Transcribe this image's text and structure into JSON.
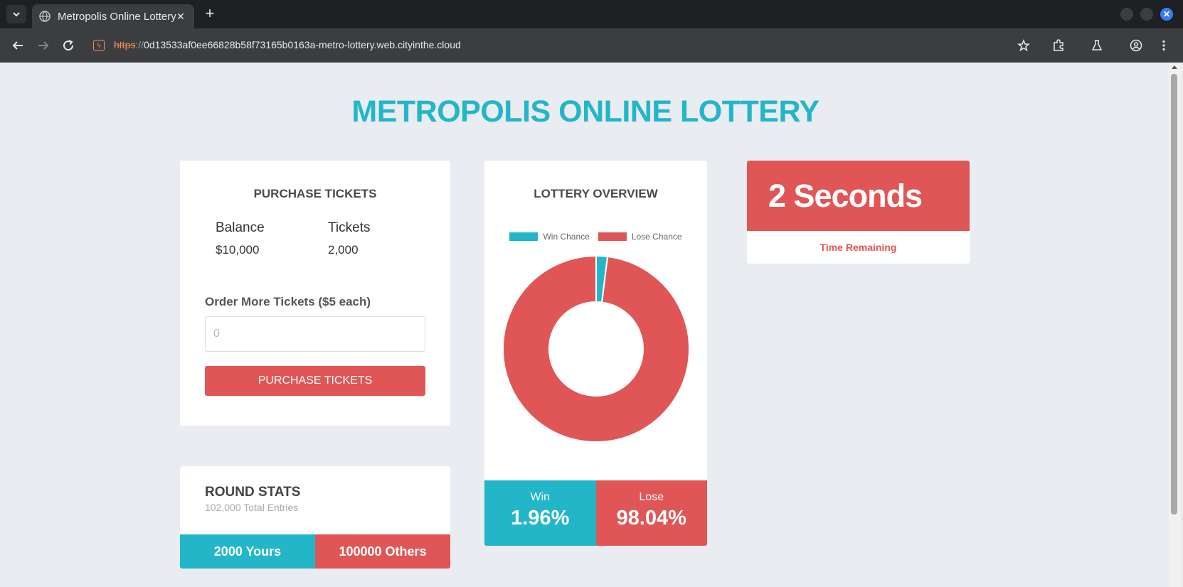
{
  "browser": {
    "tab_title": "Metropolis Online Lottery",
    "url_scheme": "https",
    "url_sep": "://",
    "url_host": "0d13533af0ee66828b58f73165b0163a-metro-lottery.web.cityinthe.cloud"
  },
  "page": {
    "title": "METROPOLIS ONLINE LOTTERY"
  },
  "purchase": {
    "heading": "PURCHASE TICKETS",
    "balance_label": "Balance",
    "balance_value": "$10,000",
    "tickets_label": "Tickets",
    "tickets_value": "2,000",
    "order_label": "Order More Tickets ($5 each)",
    "input_placeholder": "0",
    "button_label": "PURCHASE TICKETS"
  },
  "overview": {
    "heading": "LOTTERY OVERVIEW",
    "win_label": "Win",
    "win_value": "1.96%",
    "lose_label": "Lose",
    "lose_value": "98.04%"
  },
  "chart_data": {
    "type": "pie",
    "categories": [
      "Win Chance",
      "Lose Chance"
    ],
    "values": [
      1.96,
      98.04
    ],
    "colors": [
      "#22b6c8",
      "#e05556"
    ],
    "legend": "top"
  },
  "timer": {
    "value": "2 Seconds",
    "label": "Time Remaining"
  },
  "round": {
    "title": "ROUND STATS",
    "entries": "102,000 Total Entries",
    "yours": "2000 Yours",
    "others": "100000 Others"
  },
  "colors": {
    "accent_teal": "#22b6c8",
    "accent_red": "#e05556",
    "page_bg": "#e9ecf0"
  }
}
